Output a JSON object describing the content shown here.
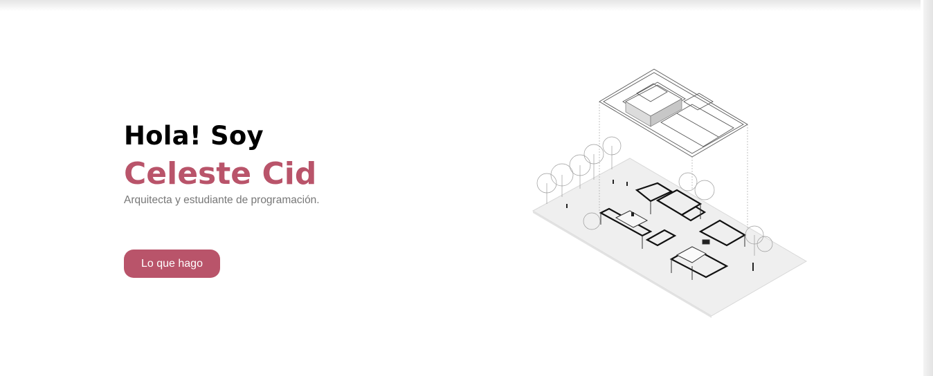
{
  "hero": {
    "greeting": "Hola! Soy",
    "name": "Celeste Cid",
    "subtitle": "Arquitecta y estudiante de programación.",
    "cta_label": "Lo que hago"
  },
  "colors": {
    "accent": "#b9546a",
    "text": "#000000",
    "muted": "#777777",
    "background": "#ffffff"
  },
  "illustration": {
    "icon": "isometric-house-plan-illustration"
  }
}
